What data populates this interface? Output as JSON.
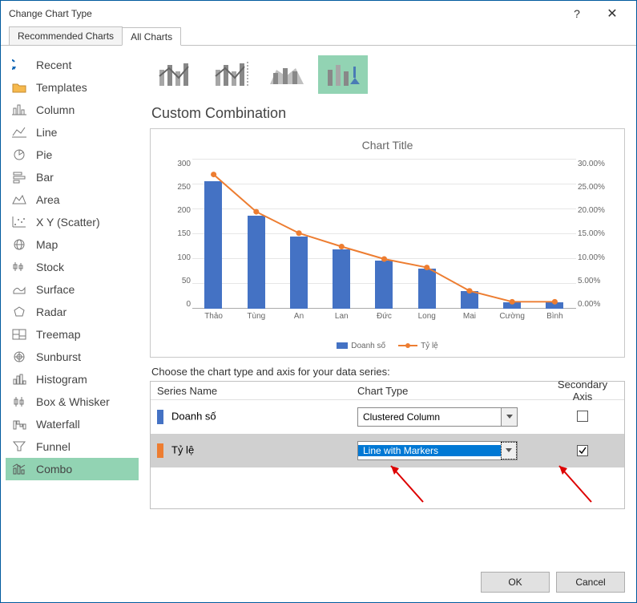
{
  "window": {
    "title": "Change Chart Type",
    "help_icon": "?",
    "close_icon": "✕"
  },
  "tabs": {
    "recommended": "Recommended Charts",
    "all": "All Charts"
  },
  "sidebar": {
    "items": [
      {
        "label": "Recent"
      },
      {
        "label": "Templates"
      },
      {
        "label": "Column"
      },
      {
        "label": "Line"
      },
      {
        "label": "Pie"
      },
      {
        "label": "Bar"
      },
      {
        "label": "Area"
      },
      {
        "label": "X Y (Scatter)"
      },
      {
        "label": "Map"
      },
      {
        "label": "Stock"
      },
      {
        "label": "Surface"
      },
      {
        "label": "Radar"
      },
      {
        "label": "Treemap"
      },
      {
        "label": "Sunburst"
      },
      {
        "label": "Histogram"
      },
      {
        "label": "Box & Whisker"
      },
      {
        "label": "Waterfall"
      },
      {
        "label": "Funnel"
      },
      {
        "label": "Combo"
      }
    ]
  },
  "section_title": "Custom Combination",
  "choose_label": "Choose the chart type and axis for your data series:",
  "table": {
    "hdr_name": "Series Name",
    "hdr_type": "Chart Type",
    "hdr_axis": "Secondary Axis",
    "rows": [
      {
        "name": "Doanh số",
        "chart_type": "Clustered Column",
        "secondary": false,
        "color": "#4472c4"
      },
      {
        "name": "Tỷ lệ",
        "chart_type": "Line with Markers",
        "secondary": true,
        "color": "#ed7d31"
      }
    ]
  },
  "buttons": {
    "ok": "OK",
    "cancel": "Cancel"
  },
  "chart_data": {
    "type": "combo",
    "title": "Chart Title",
    "categories": [
      "Thảo",
      "Tùng",
      "An",
      "Lan",
      "Đức",
      "Long",
      "Mai",
      "Cường",
      "Bình"
    ],
    "y1_ticks": [
      0,
      50,
      100,
      150,
      200,
      250,
      300
    ],
    "y2_ticks": [
      "0.00%",
      "5.00%",
      "10.00%",
      "15.00%",
      "20.00%",
      "25.00%",
      "30.00%"
    ],
    "ylim1": [
      0,
      300
    ],
    "ylim2": [
      0,
      30
    ],
    "series": [
      {
        "name": "Doanh số",
        "type": "bar",
        "axis": "primary",
        "color": "#4472c4",
        "values": [
          257,
          187,
          145,
          120,
          97,
          80,
          35,
          13,
          13
        ]
      },
      {
        "name": "Tỷ lệ",
        "type": "line_marker",
        "axis": "secondary",
        "color": "#ed7d31",
        "values": [
          27.0,
          19.5,
          15.2,
          12.5,
          10.0,
          8.3,
          3.6,
          1.4,
          1.4
        ]
      }
    ],
    "legend": [
      "Doanh số",
      "Tỷ lệ"
    ]
  }
}
